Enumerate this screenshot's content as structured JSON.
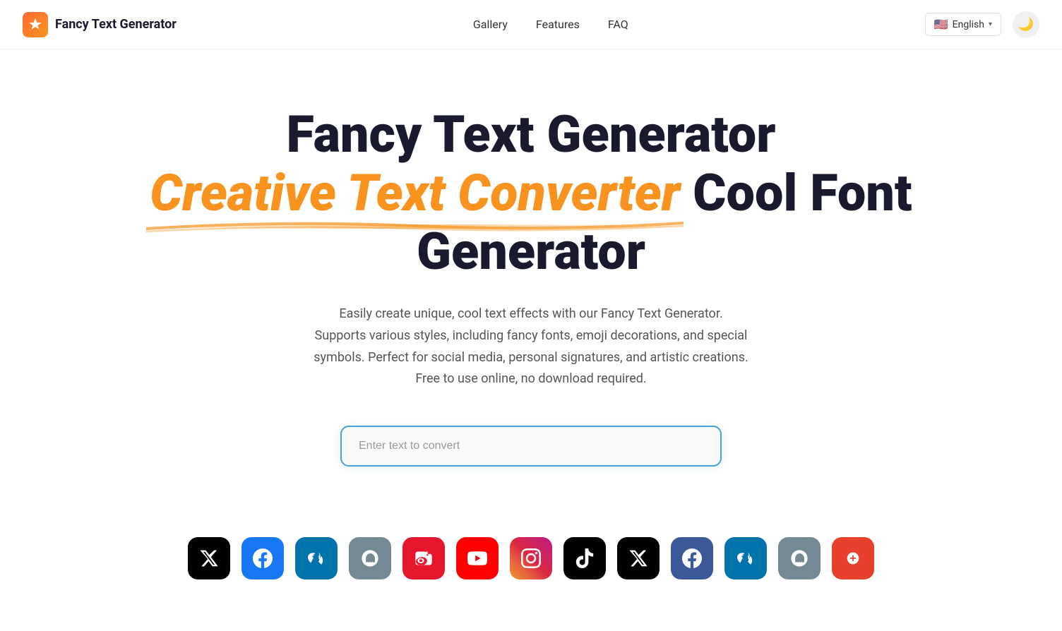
{
  "brand": {
    "logo_char": "✦",
    "title": "Fancy Text Generator"
  },
  "nav": {
    "items": [
      {
        "label": "Gallery",
        "href": "#"
      },
      {
        "label": "Features",
        "href": "#"
      },
      {
        "label": "FAQ",
        "href": "#"
      }
    ]
  },
  "language": {
    "flag": "🇺🇸",
    "label": "English",
    "prefix": "us"
  },
  "hero": {
    "title_line1": "Fancy Text Generator",
    "title_line2_orange": "Creative Text Converter",
    "title_line2_dark": " Cool Font",
    "title_line3": "Generator",
    "description": "Easily create unique, cool text effects with our Fancy Text Generator. Supports various styles, including fancy fonts, emoji decorations, and special symbols. Perfect for social media, personal signatures, and artistic creations. Free to use online, no download required.",
    "input_placeholder": "Enter text to convert"
  },
  "social_icons": [
    {
      "id": "twitter-x",
      "label": "X (Twitter)",
      "style": "twitter-x"
    },
    {
      "id": "facebook",
      "label": "Facebook",
      "style": "facebook"
    },
    {
      "id": "wordpress",
      "label": "WordPress",
      "style": "wordpress"
    },
    {
      "id": "ghost",
      "label": "Ghost",
      "style": "ghost"
    },
    {
      "id": "weibo",
      "label": "Weibo",
      "style": "weibo"
    },
    {
      "id": "youtube",
      "label": "YouTube",
      "style": "youtube"
    },
    {
      "id": "instagram",
      "label": "Instagram",
      "style": "instagram"
    },
    {
      "id": "tiktok",
      "label": "TikTok",
      "style": "tiktok"
    },
    {
      "id": "twitter-x2",
      "label": "X (Twitter)",
      "style": "twitter-x2"
    },
    {
      "id": "facebook2",
      "label": "Facebook",
      "style": "facebook2"
    },
    {
      "id": "wordpress2",
      "label": "WordPress",
      "style": "wordpress2"
    },
    {
      "id": "ghost2",
      "label": "Ghost",
      "style": "ghost2"
    },
    {
      "id": "partial",
      "label": "More",
      "style": "partial"
    }
  ]
}
